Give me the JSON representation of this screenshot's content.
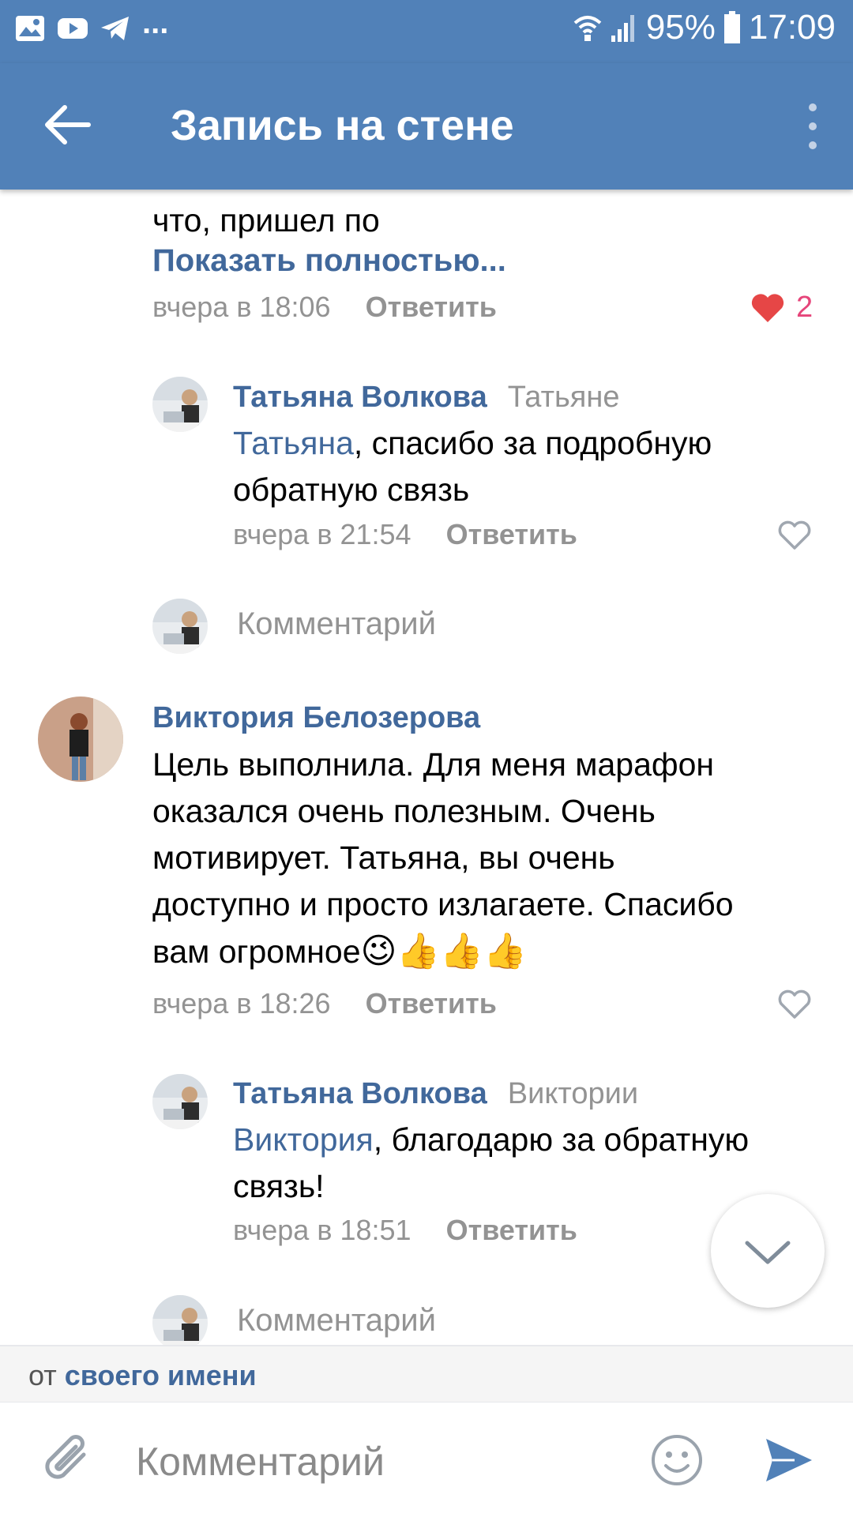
{
  "status_bar": {
    "battery": "95%",
    "time": "17:09",
    "notification_icons": [
      "image-icon",
      "youtube-icon",
      "telegram-icon"
    ],
    "more_notifications": "..."
  },
  "app_bar": {
    "title": "Запись на стене",
    "back_icon": "arrow-left-icon",
    "menu_icon": "more-vertical-icon",
    "background": "#5181b8"
  },
  "comments": [
    {
      "text_tail": "что,  пришел по",
      "show_more": "Показать полностью...",
      "time": "вчера в 18:06",
      "reply_label": "Ответить",
      "likes": "2",
      "liked": true
    },
    {
      "author": "Татьяна Волкова",
      "addressee": "Татьяне",
      "mention": "Татьяна",
      "text_line1": ", спасибо за подробную",
      "text_line2": "обратную связь",
      "time": "вчера в 21:54",
      "reply_label": "Ответить",
      "liked": false
    },
    {
      "author": "Виктория Белозерова",
      "text_lines": [
        "Цель выполнила. Для меня марафон",
        "оказался очень полезным. Очень",
        "мотивирует. Татьяна, вы очень",
        "доступно и просто излагаете. Спасибо",
        "вам огромное"
      ],
      "emojis": "😉👍👍👍",
      "time": "вчера в 18:26",
      "reply_label": "Ответить",
      "liked": false
    },
    {
      "author": "Татьяна Волкова",
      "addressee": "Виктории",
      "mention": "Виктория",
      "text_line1": ", благодарю за обратную",
      "text_line2": "связь!",
      "time": "вчера в 18:51",
      "reply_label": "Ответить"
    }
  ],
  "reply_prompts": [
    "Комментарий",
    "Комментарий"
  ],
  "from_line": {
    "prefix": "от ",
    "name": "своего имени"
  },
  "composer": {
    "placeholder": "Комментарий",
    "attach_icon": "paperclip-icon",
    "emoji_icon": "smiley-icon",
    "send_icon": "send-icon"
  },
  "colors": {
    "link": "#41689b",
    "meta": "#939393",
    "like": "#e6457a"
  }
}
